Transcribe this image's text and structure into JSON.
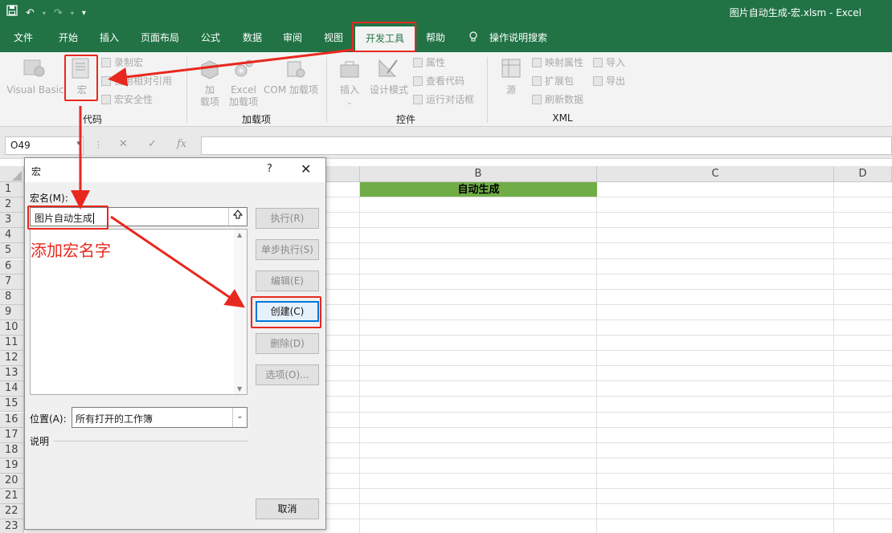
{
  "window": {
    "title": "图片自动生成-宏.xlsm  -  Excel",
    "qat_icons": [
      "save-icon",
      "undo-icon",
      "redo-icon",
      "customize-qat-icon"
    ]
  },
  "menu": {
    "tabs": [
      "文件",
      "开始",
      "插入",
      "页面布局",
      "公式",
      "数据",
      "审阅",
      "视图",
      "开发工具",
      "帮助",
      "操作说明搜索"
    ],
    "active": "开发工具"
  },
  "ribbon": {
    "code": {
      "visual_basic": "Visual Basic",
      "macros": "宏",
      "record_macro": "录制宏",
      "relative_refs": "使用相对引用",
      "macro_security": "宏安全性",
      "group_label": "代码"
    },
    "addins": {
      "addins_line1": "加",
      "addins_line2": "载项",
      "excel_line1": "Excel",
      "excel_line2": "加载项",
      "com_addins": "COM 加载项",
      "group_label": "加载项"
    },
    "controls": {
      "insert": "插入",
      "design_mode": "设计模式",
      "properties": "属性",
      "view_code": "查看代码",
      "run_dialog": "运行对话框",
      "group_label": "控件"
    },
    "xml": {
      "source": "源",
      "map_properties": "映射属性",
      "expansion_packs": "扩展包",
      "refresh_data": "刷新数据",
      "import": "导入",
      "export": "导出",
      "group_label": "XML"
    }
  },
  "formula_bar": {
    "name_box": "O49",
    "fx": "fx",
    "value": ""
  },
  "sheet": {
    "columns": [
      "B",
      "C",
      "D"
    ],
    "rows": [
      "1",
      "2",
      "3",
      "4",
      "5",
      "6",
      "7",
      "8",
      "9",
      "10",
      "11",
      "12",
      "13",
      "14",
      "15",
      "16",
      "17",
      "18",
      "19",
      "20",
      "21",
      "22",
      "23"
    ],
    "b1_value": "自动生成"
  },
  "dialog": {
    "title": "宏",
    "help": "?",
    "macro_name_label": "宏名(M):",
    "macro_name_value": "图片自动生成",
    "buttons": {
      "run": "执行(R)",
      "step_into": "单步执行(S)",
      "edit": "编辑(E)",
      "create": "创建(C)",
      "delete": "删除(D)",
      "options": "选项(O)...",
      "cancel": "取消"
    },
    "location_label": "位置(A):",
    "location_value": "所有打开的工作簿",
    "description_label": "说明"
  },
  "annotation": {
    "text": "添加宏名字",
    "color": "#e8281e"
  },
  "colors": {
    "excel_green": "#217346",
    "header_fill": "#70ad47",
    "primary_button_border": "#0078d7"
  }
}
